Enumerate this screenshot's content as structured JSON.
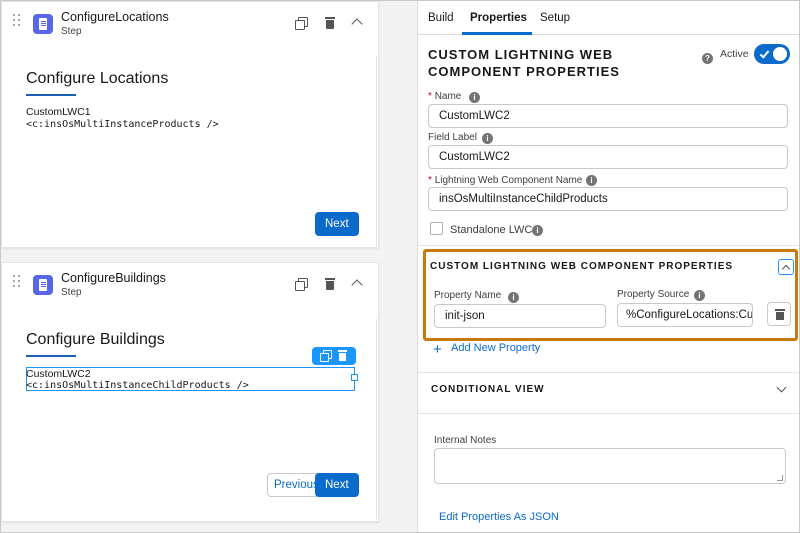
{
  "canvas": {
    "steps": [
      {
        "title": "ConfigureLocations",
        "subtitle": "Step",
        "body_title": "Configure Locations",
        "lwc_label": "CustomLWC1",
        "lwc_code": "<c:insOsMultiInstanceProducts />",
        "next_label": "Next"
      },
      {
        "title": "ConfigureBuildings",
        "subtitle": "Step",
        "body_title": "Configure Buildings",
        "lwc_label": "CustomLWC2",
        "lwc_code": "<c:insOsMultiInstanceChildProducts />",
        "previous_label": "Previous",
        "next_label": "Next"
      }
    ]
  },
  "panel": {
    "tabs": [
      {
        "label": "Build"
      },
      {
        "label": "Properties"
      },
      {
        "label": "Setup"
      }
    ],
    "title": "CUSTOM LIGHTNING WEB COMPONENT PROPERTIES",
    "active_label": "Active",
    "active_value": true,
    "fields": {
      "name": {
        "label": "Name",
        "value": "CustomLWC2"
      },
      "field_label": {
        "label": "Field Label",
        "value": "CustomLWC2"
      },
      "lwc_name": {
        "label": "Lightning Web Component Name",
        "value": "insOsMultiInstanceChildProducts"
      },
      "standalone": {
        "label": "Standalone LWC"
      }
    },
    "lwc_properties": {
      "header": "CUSTOM LIGHTNING WEB COMPONENT PROPERTIES",
      "property_name_label": "Property Name",
      "property_source_label": "Property Source",
      "property_name_value": "init-json",
      "property_source_value": "%ConfigureLocations:Cu",
      "add_label": "Add New Property"
    },
    "conditional_view": {
      "header": "CONDITIONAL VIEW"
    },
    "internal_notes": {
      "label": "Internal Notes"
    },
    "edit_json_label": "Edit Properties As JSON"
  },
  "colors": {
    "brand": "#0b6bcb",
    "step_icon": "#5867e8",
    "highlight": "#c97a0e",
    "selection": "#1b96ff"
  },
  "icons": [
    "drag-handle-icon",
    "step-icon",
    "copy-icon",
    "trash-icon",
    "chevron-up-icon",
    "chevron-down-icon",
    "help-icon",
    "check-icon",
    "plus-icon"
  ]
}
